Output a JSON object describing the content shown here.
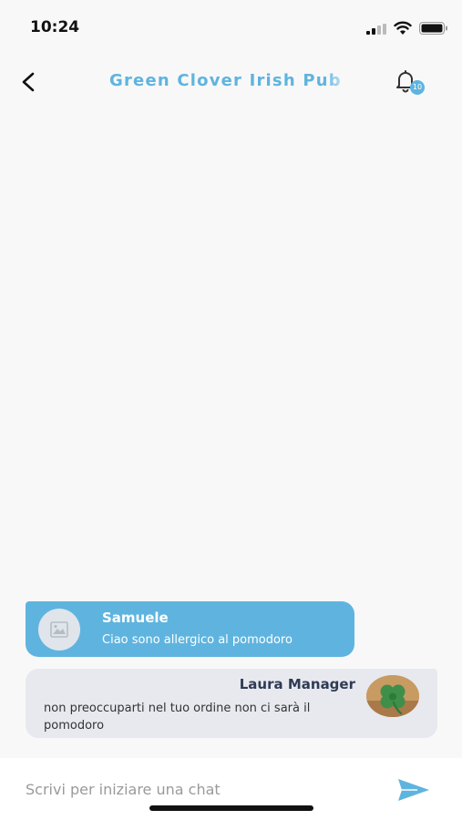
{
  "status_bar": {
    "time": "10:24"
  },
  "header": {
    "title": "Green Clover Irish Pub",
    "notification_count": "10"
  },
  "messages": [
    {
      "sender": "Samuele",
      "text": "Ciao sono allergico al pomodoro"
    },
    {
      "sender": "Laura Manager",
      "text": "non preoccuparti nel tuo ordine non ci sarà il pomodoro"
    }
  ],
  "composer": {
    "placeholder": "Scrivi per iniziare una chat",
    "value": ""
  },
  "icons": {
    "back": "chevron-left-icon",
    "notifications": "bell-icon",
    "send": "send-icon",
    "image_placeholder": "image-icon",
    "manager_avatar": "clover-icon"
  },
  "colors": {
    "accent": "#5fb4df",
    "manager_bubble": "#e7e9ee",
    "manager_name": "#2f3b55"
  }
}
